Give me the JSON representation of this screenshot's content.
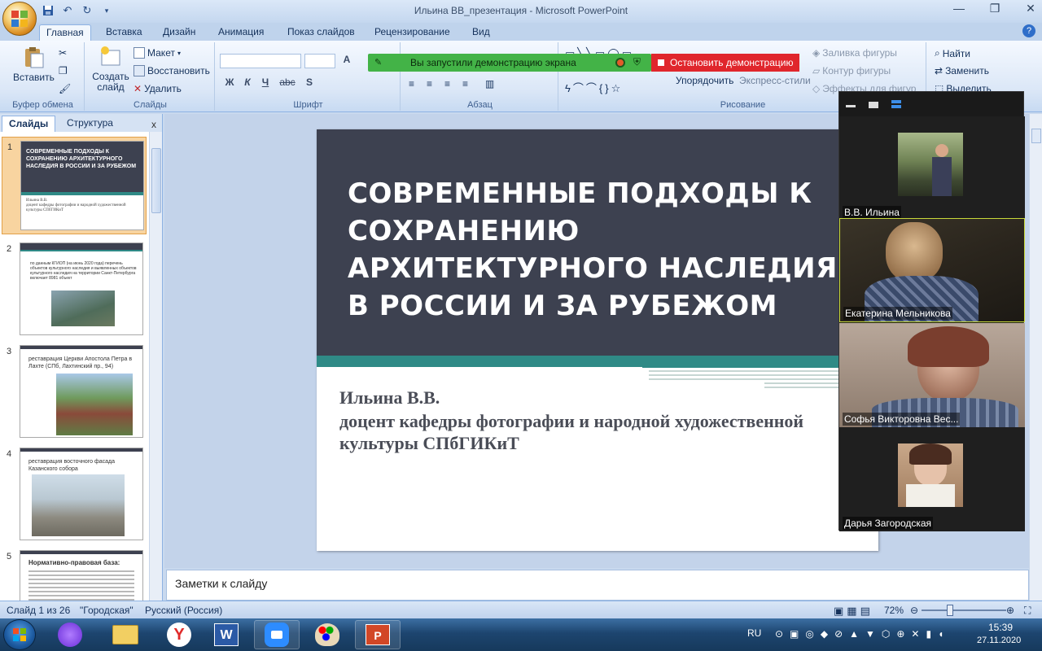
{
  "window": {
    "title": "Ильина ВВ_презентация - Microsoft PowerPoint"
  },
  "ribbon_tabs": [
    "Главная",
    "Вставка",
    "Дизайн",
    "Анимация",
    "Показ слайдов",
    "Рецензирование",
    "Вид"
  ],
  "ribbon": {
    "clipboard": {
      "label": "Буфер обмена",
      "paste": "Вставить"
    },
    "slides": {
      "label": "Слайды",
      "create": "Создать слайд",
      "layout": "Макет",
      "reset": "Восстановить",
      "delete": "Удалить"
    },
    "font": {
      "label": "Шрифт",
      "bold": "Ж",
      "italic": "К",
      "underline": "Ч",
      "strike": "abc",
      "shadow": "S"
    },
    "paragraph": {
      "label": "Абзац"
    },
    "drawing": {
      "label": "Рисование",
      "arrange": "Упорядочить",
      "quick_styles": "Экспресс-стили",
      "fill": "Заливка фигуры",
      "outline": "Контур фигуры",
      "effects": "Эффекты для фигур"
    },
    "editing": {
      "find": "Найти",
      "replace": "Заменить",
      "select": "Выделить"
    }
  },
  "screen_share": {
    "status": "Вы запустили демонстрацию экрана",
    "stop": "Остановить демонстрацию"
  },
  "left_panel": {
    "tabs": [
      "Слайды",
      "Структура"
    ],
    "close": "x",
    "thumbs": [
      {
        "num": "1",
        "title": "СОВРЕМЕННЫЕ ПОДХОДЫ К СОХРАНЕНИЮ АРХИТЕКТУРНОГО НАСЛЕДИЯ В РОССИИ И ЗА РУБЕЖОМ",
        "sub1": "Ильина В.В.",
        "sub2": "доцент кафедры фотографии и народной художественной культуры СПбГИКиТ"
      },
      {
        "num": "2",
        "text": "по данным КГИОП (на июнь 2020 года) перечень объектов культурного наследия и выявленных объектов культурного наследия на территории Санкт-Петербурга включает 8981 объект"
      },
      {
        "num": "3",
        "text": "реставрация Церкви Апостола Петра в Лахте (СПб, Лахтинский пр., 94)"
      },
      {
        "num": "4",
        "text": "реставрация восточного фасада Казанского собора"
      },
      {
        "num": "5",
        "text": "Нормативно-правовая база:"
      }
    ]
  },
  "slide": {
    "title": "СОВРЕМЕННЫЕ ПОДХОДЫ К СОХРАНЕНИЮ АРХИТЕКТУРНОГО НАСЛЕДИЯ В РОССИИ И ЗА РУБЕЖОМ",
    "subtitle_line1": "Ильина В.В.",
    "subtitle_line2": "доцент кафедры фотографии и народной художественной культуры СПбГИКиТ"
  },
  "notes_placeholder": "Заметки к слайду",
  "status": {
    "slide_of": "Слайд 1 из 26",
    "theme": "\"Городская\"",
    "language": "Русский (Россия)",
    "zoom": "72%"
  },
  "participants": [
    {
      "name": "В.В. Ильина",
      "type": "avatar"
    },
    {
      "name": "Екатерина Мельникова",
      "type": "video",
      "active": true
    },
    {
      "name": "Софья Викторовна Вес...",
      "type": "video"
    },
    {
      "name": "Дарья Загородская",
      "type": "avatar"
    }
  ],
  "taskbar": {
    "lang": "RU",
    "time": "15:39",
    "date": "27.11.2020"
  },
  "colors": {
    "slide_dark": "#3d4150",
    "slide_teal": "#2f8a86",
    "share_green": "#43b347",
    "stop_red": "#e0262c"
  }
}
